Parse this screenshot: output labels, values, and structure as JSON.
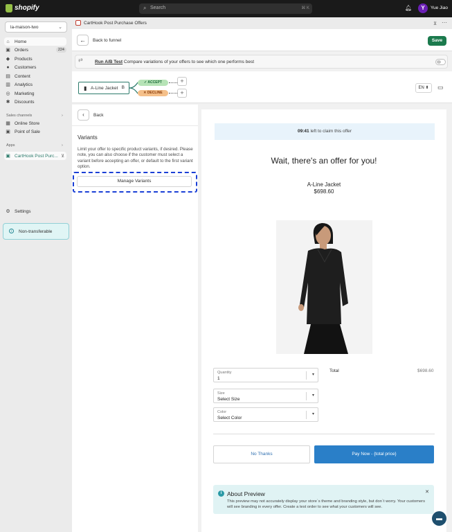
{
  "topbar": {
    "brand": "shopify",
    "search_placeholder": "Search",
    "search_shortcut": "⌘ K",
    "user_initial": "Y",
    "user_name": "Yue Jiao"
  },
  "sidebar": {
    "store": "la-maison-two",
    "nav": [
      {
        "label": "Home",
        "icon": "home-icon"
      },
      {
        "label": "Orders",
        "icon": "orders-icon",
        "count": "224"
      },
      {
        "label": "Products",
        "icon": "tag-icon"
      },
      {
        "label": "Customers",
        "icon": "person-icon"
      },
      {
        "label": "Content",
        "icon": "content-icon"
      },
      {
        "label": "Analytics",
        "icon": "analytics-icon"
      },
      {
        "label": "Marketing",
        "icon": "marketing-icon"
      },
      {
        "label": "Discounts",
        "icon": "discount-icon"
      }
    ],
    "sales_channels_title": "Sales channels",
    "sales_channels": [
      {
        "label": "Online Store"
      },
      {
        "label": "Point of Sale"
      }
    ],
    "apps_title": "Apps",
    "apps": [
      {
        "label": "CartHook Post Purc..."
      }
    ],
    "settings_label": "Settings",
    "non_transferable_label": "Non-transferable"
  },
  "app": {
    "title": "CartHook Post Purchase Offers",
    "back_to_funnel": "Back to funnel",
    "save": "Save",
    "ab_link": "Run A/B Test",
    "ab_text": "Compare variations of your offers to see which one performs best",
    "funnel_node": "A-Line Jacket",
    "funnel_node_badge": "B",
    "accept": "ACCEPT",
    "decline": "DECLINE",
    "language": "EN ⬍"
  },
  "panel": {
    "back": "Back",
    "title": "Variants",
    "description": "Limit your offer to specific product variants, if desired. Please note, you can also choose if the customer must select a variant before accepting an offer, or default to the first variant option.",
    "manage_button": "Manage Variants"
  },
  "preview": {
    "timer_time": "09:41",
    "timer_text": " left to claim this offer",
    "headline": "Wait, there's an offer for you!",
    "product_name": "A-Line Jacket",
    "product_price": "$698.60",
    "quantity_label": "Quantity",
    "quantity_value": "1",
    "size_label": "Size",
    "size_value": "Select Size",
    "color_label": "Color",
    "color_value": "Select Color",
    "total_label": "Total",
    "total_value": "$698.60",
    "no_thanks": "No Thanks",
    "pay_now": "Pay Now - {total price}",
    "about_title": "About Preview",
    "about_body": "This preview may not accurately display your store`s theme and branding style, but don`t worry. Your customers will see branding in every offer. Create a test order to see what your customers will see."
  }
}
